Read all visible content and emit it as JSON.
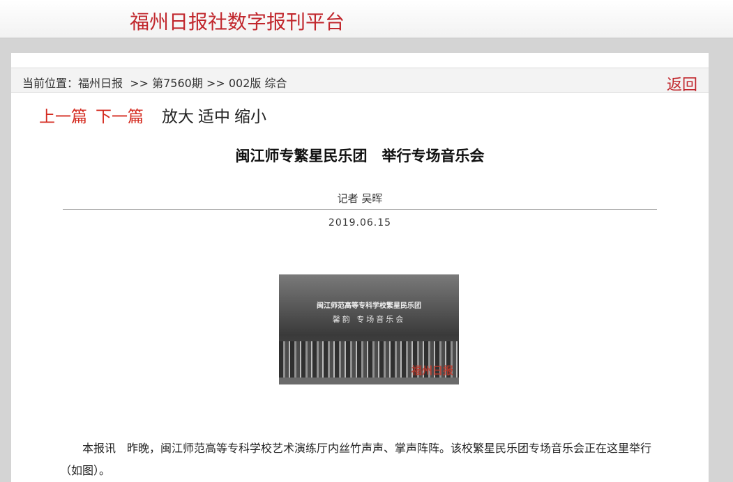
{
  "header": {
    "site_title": "福州日报社数字报刊平台"
  },
  "breadcrumb": {
    "label": "当前位置：",
    "items": [
      "福州日报",
      ">>",
      "第7560期",
      ">>",
      "002版 综合"
    ],
    "back_label": "返回"
  },
  "toolbar": {
    "prev": "上一篇",
    "next": "下一篇",
    "zoom_in": "放大",
    "zoom_fit": "适中",
    "zoom_out": "缩小"
  },
  "article": {
    "headline": "闽江师专繁星民乐团　举行专场音乐会",
    "author": "记者 吴晖",
    "date": "2019.06.15",
    "photo": {
      "caption_line1": "闽江师范高等专科学校繁星民乐团",
      "caption_line2": "馨韵 专场音乐会",
      "watermark": "福州日报"
    },
    "body": "本报讯　昨晚，闽江师范高等专科学校艺术演练厅内丝竹声声、掌声阵阵。该校繁星民乐团专场音乐会正在这里举行（如图）。"
  }
}
